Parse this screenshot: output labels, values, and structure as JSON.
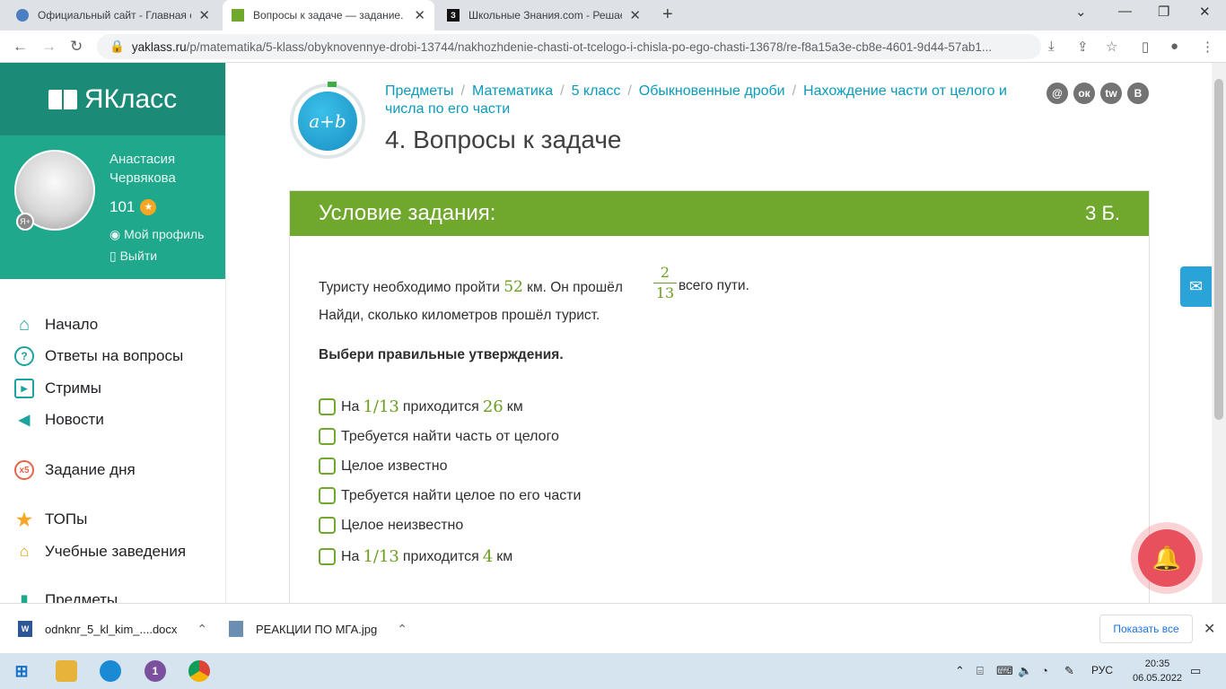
{
  "browser": {
    "tabs": [
      {
        "title": "Официальный сайт - Главная ст",
        "active": false
      },
      {
        "title": "Вопросы к задаче — задание. М",
        "active": true
      },
      {
        "title": "Школьные Знания.com - Решае",
        "active": false
      }
    ],
    "url_domain": "yaklass.ru",
    "url_path": "/p/matematika/5-klass/obyknovennye-drobi-13744/nakhozhdenie-chasti-ot-tcelogo-i-chisla-po-ego-chasti-13678/re-f8a15a3e-cb8e-4601-9d44-57ab1..."
  },
  "sidebar": {
    "logo": "ЯКласс",
    "user_name": "Анастасия Червякова",
    "points": "101",
    "badge": "Я+",
    "profile_link": "Мой профиль",
    "logout_link": "Выйти",
    "menu": [
      {
        "label": "Начало",
        "icon": "home-icon"
      },
      {
        "label": "Ответы на вопросы",
        "icon": "question-icon"
      },
      {
        "label": "Стримы",
        "icon": "play-icon"
      },
      {
        "label": "Новости",
        "icon": "megaphone-icon"
      },
      {
        "label": "Задание дня",
        "icon": "x5-icon"
      },
      {
        "label": "ТОПы",
        "icon": "star-icon"
      },
      {
        "label": "Учебные заведения",
        "icon": "building-icon"
      },
      {
        "label": "Предметы",
        "icon": "subjects-icon"
      }
    ]
  },
  "header": {
    "logo_text": "a+b",
    "breadcrumbs": [
      "Предметы",
      "Математика",
      "5 класс",
      "Обыкновенные дроби",
      "Нахождение части от целого и числа по его части"
    ],
    "page_title": "4. Вопросы к задаче",
    "social": [
      "@",
      "ок",
      "tw",
      "В"
    ]
  },
  "task": {
    "heading": "Условие задания:",
    "points": "3 Б.",
    "text_part1": "Туристу необходимо пройти",
    "distance": "52",
    "text_part2": "км. Он прошёл",
    "frac_num": "2",
    "frac_den": "13",
    "text_part3": "всего пути.",
    "question": "Найди, сколько километров прошёл турист.",
    "instruction": "Выбери правильные утверждения.",
    "options": [
      {
        "pre": "На",
        "math": "1/13",
        "mid": "приходится",
        "math2": "26",
        "post": "км"
      },
      {
        "text": "Требуется найти часть от целого"
      },
      {
        "text": "Целое известно"
      },
      {
        "text": "Требуется найти целое по его части"
      },
      {
        "text": "Целое неизвестно"
      },
      {
        "pre": "На",
        "math": "1/13",
        "mid": "приходится",
        "math2": "4",
        "post": "км"
      }
    ]
  },
  "downloads": {
    "items": [
      "odnknr_5_kl_kim_....docx",
      "РЕАКЦИИ ПО МГА.jpg"
    ],
    "show_all": "Показать все"
  },
  "taskbar": {
    "lang": "РУС",
    "time": "20:35",
    "date": "06.05.2022"
  }
}
